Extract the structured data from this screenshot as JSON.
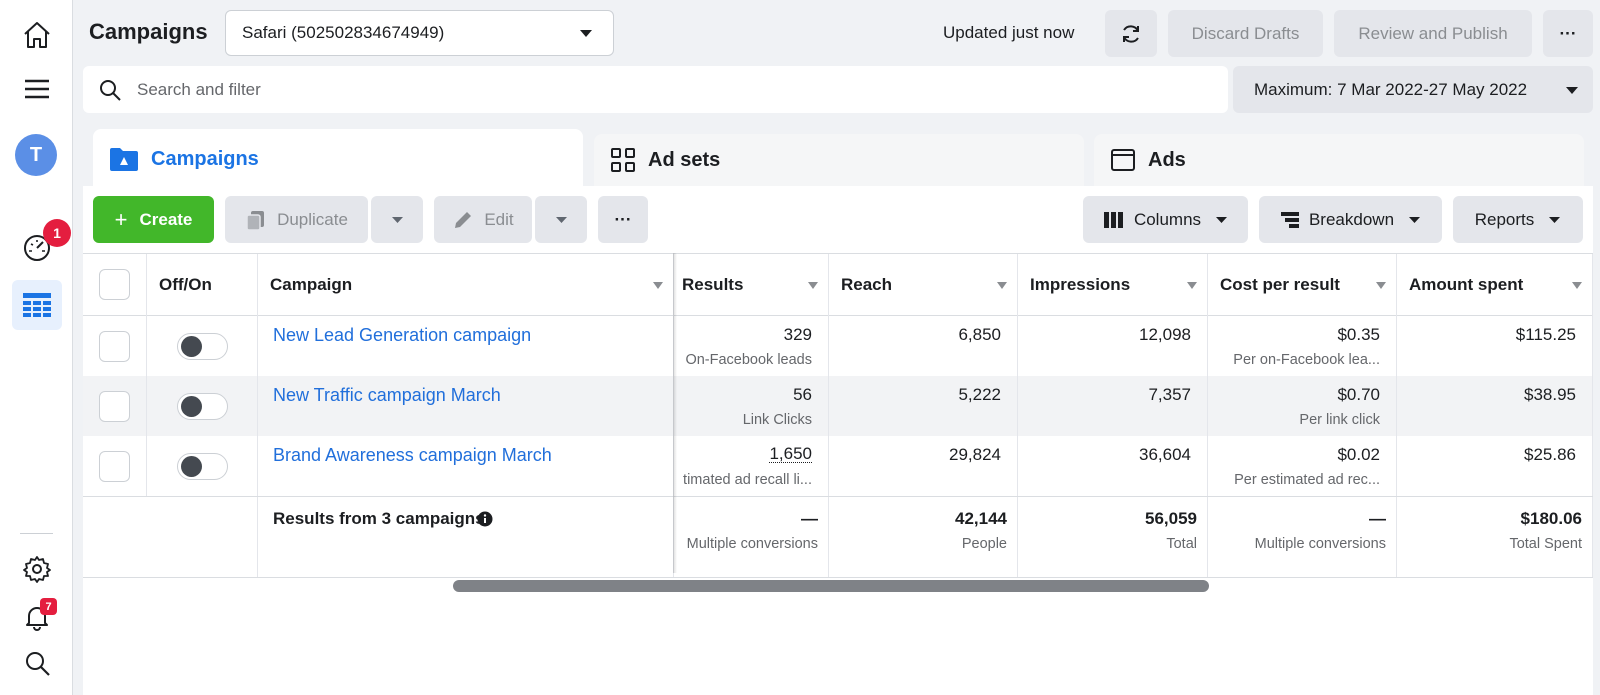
{
  "rail": {
    "avatar_initial": "T",
    "alerts_badge": "1",
    "notifications_badge": "7"
  },
  "header": {
    "title": "Campaigns",
    "account": "Safari (502502834674949)",
    "updated": "Updated just now",
    "discard_label": "Discard Drafts",
    "review_label": "Review and Publish",
    "more_label": "···"
  },
  "search": {
    "placeholder": "Search and filter"
  },
  "date_range": "Maximum: 7 Mar 2022-27 May 2022",
  "tabs": [
    {
      "label": "Campaigns",
      "active": true
    },
    {
      "label": "Ad sets",
      "active": false
    },
    {
      "label": "Ads",
      "active": false
    }
  ],
  "toolbar": {
    "create_label": "Create",
    "duplicate_label": "Duplicate",
    "edit_label": "Edit",
    "more_label": "···",
    "columns_label": "Columns",
    "breakdown_label": "Breakdown",
    "reports_label": "Reports"
  },
  "table": {
    "headers": {
      "offon": "Off/On",
      "campaign": "Campaign",
      "results": "Results",
      "reach": "Reach",
      "impressions": "Impressions",
      "cost_per_result": "Cost per result",
      "amount_spent": "Amount spent"
    },
    "rows": [
      {
        "name": "New Lead Generation campaign",
        "results": "329",
        "results_sub": "On-Facebook leads",
        "reach": "6,850",
        "impressions": "12,098",
        "cpr": "$0.35",
        "cpr_sub": "Per on-Facebook lea...",
        "spent": "$115.25"
      },
      {
        "name": "New Traffic campaign March",
        "results": "56",
        "results_sub": "Link Clicks",
        "reach": "5,222",
        "impressions": "7,357",
        "cpr": "$0.70",
        "cpr_sub": "Per link click",
        "spent": "$38.95"
      },
      {
        "name": "Brand Awareness campaign March",
        "results": "1,650",
        "results_sub": "timated ad recall li...",
        "reach": "29,824",
        "impressions": "36,604",
        "cpr": "$0.02",
        "cpr_sub": "Per estimated ad rec...",
        "spent": "$25.86"
      }
    ],
    "totals": {
      "label": "Results from 3 campaigns",
      "results": "—",
      "results_sub": "Multiple conversions",
      "reach": "42,144",
      "reach_sub": "People",
      "impressions": "56,059",
      "impressions_sub": "Total",
      "cpr": "—",
      "cpr_sub": "Multiple conversions",
      "spent": "$180.06",
      "spent_sub": "Total Spent"
    }
  },
  "colors": {
    "accent": "#1b74e4",
    "create": "#42b72a",
    "link": "#216fdb",
    "badge": "#e41e3f"
  }
}
